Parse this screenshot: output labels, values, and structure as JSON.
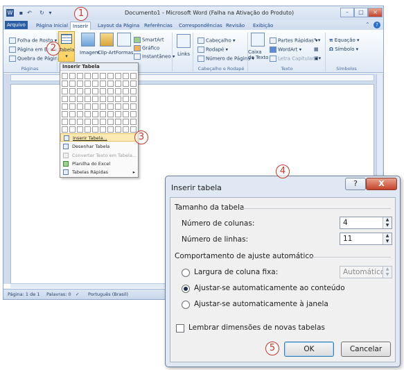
{
  "word": {
    "title": "Documento1 - Microsoft Word (Falha na Ativação do Produto)",
    "tabs": [
      "Arquivo",
      "Página Inicial",
      "Inserir",
      "Layout da Página",
      "Referências",
      "Correspondências",
      "Revisão",
      "Exibição"
    ],
    "ribbon": {
      "paginas": {
        "items": [
          "Folha de Rosto",
          "Página em Branco",
          "Quebra de Página"
        ],
        "label": "Páginas"
      },
      "tabela": {
        "label": "Tabela"
      },
      "ilustracoes": {
        "imagem": "Imagem",
        "clipart": "Clip-Art",
        "formas": "Formas",
        "smartart": "SmartArt",
        "grafico": "Gráfico",
        "instantaneo": "Instantâneo"
      },
      "links": {
        "label": "Links"
      },
      "cabecalho": {
        "items": [
          "Cabeçalho",
          "Rodapé",
          "Número de Página"
        ],
        "label": "Cabeçalho e Rodapé"
      },
      "texto": {
        "caixa": "Caixa de Texto",
        "items": [
          "Partes Rápidas",
          "WordArt",
          "Letra Capitular"
        ],
        "label": "Texto"
      },
      "simbolos": {
        "items": [
          "Equação",
          "Símbolo"
        ],
        "label": "Símbolos",
        "glyphs": [
          "π",
          "Ω"
        ]
      }
    },
    "status": {
      "page": "Página: 1 de 1",
      "words": "Palavras: 0",
      "language": "Português (Brasil)"
    }
  },
  "tablemenu": {
    "header": "Inserir Tabela",
    "items": [
      {
        "label": "Inserir Tabela...",
        "enabled": true,
        "highlighted": true
      },
      {
        "label": "Desenhar Tabela",
        "enabled": true
      },
      {
        "label": "Converter Texto em Tabela...",
        "enabled": false
      },
      {
        "label": "Planilha do Excel",
        "enabled": true
      },
      {
        "label": "Tabelas Rápidas",
        "enabled": true
      }
    ]
  },
  "dialog": {
    "title": "Inserir tabela",
    "help": "?",
    "close": "X",
    "size_group": "Tamanho da tabela",
    "columns_label": "Número de colunas:",
    "columns_value": "4",
    "rows_label": "Número de linhas:",
    "rows_value": "11",
    "autofit_group": "Comportamento de ajuste automático",
    "opt_fixed": "Largura de coluna fixa:",
    "fixed_value": "Automático",
    "opt_content": "Ajustar-se automaticamente ao conteúdo",
    "opt_window": "Ajustar-se automaticamente à janela",
    "remember": "Lembrar dimensões de novas tabelas",
    "ok": "OK",
    "cancel": "Cancelar"
  },
  "markers": [
    "1",
    "2",
    "3",
    "4",
    "5"
  ]
}
